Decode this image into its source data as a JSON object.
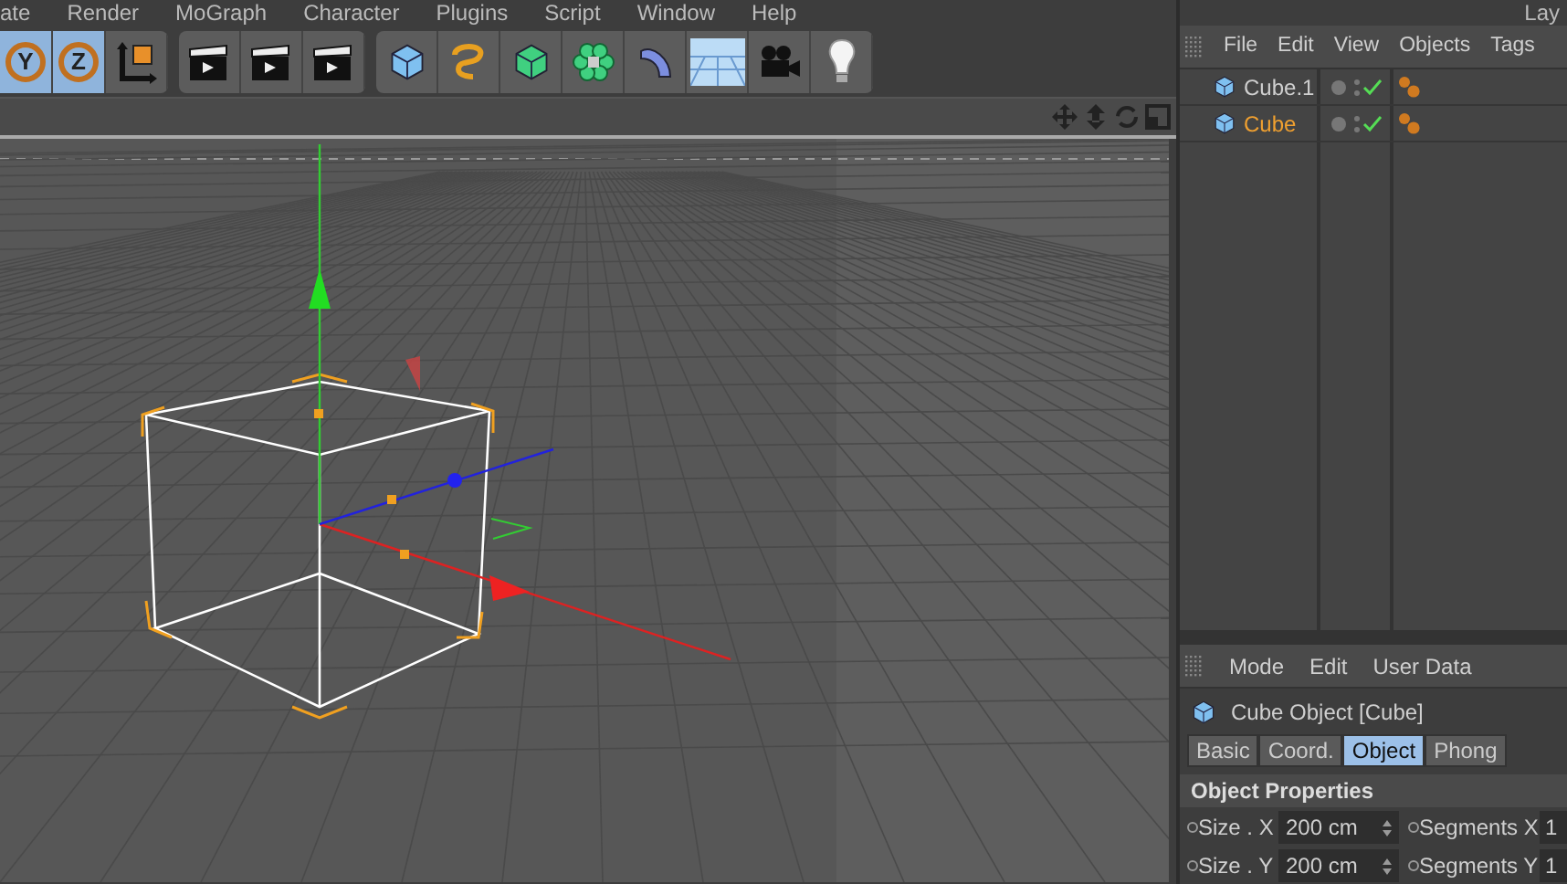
{
  "menu_bar": {
    "items": [
      "ate",
      "Render",
      "MoGraph",
      "Character",
      "Plugins",
      "Script",
      "Window",
      "Help"
    ],
    "right_text": "Lay"
  },
  "toolbar": {
    "axis_buttons": [
      {
        "label": "Y",
        "selected": true
      },
      {
        "label": "Z",
        "selected": true
      }
    ]
  },
  "object_manager": {
    "menu": [
      "File",
      "Edit",
      "View",
      "Objects",
      "Tags"
    ],
    "objects": [
      {
        "name": "Cube.1",
        "selected": false
      },
      {
        "name": "Cube",
        "selected": true
      }
    ]
  },
  "attribute_manager": {
    "menu": [
      "Mode",
      "Edit",
      "User Data"
    ],
    "title": "Cube Object [Cube]",
    "tabs": [
      {
        "label": "Basic",
        "selected": false
      },
      {
        "label": "Coord.",
        "selected": false
      },
      {
        "label": "Object",
        "selected": true
      },
      {
        "label": "Phong",
        "selected": false
      }
    ],
    "section": "Object Properties",
    "rows": [
      {
        "label": "Size . X",
        "value": "200 cm",
        "label_2": "Segments X",
        "value_2": "1"
      },
      {
        "label": "Size . Y",
        "value": "200 cm",
        "label_2": "Segments Y",
        "value_2": "1"
      }
    ]
  }
}
